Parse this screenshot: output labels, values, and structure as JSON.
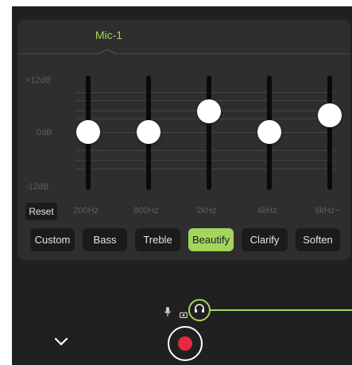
{
  "colors": {
    "accent": "#a4d65e",
    "background": "#202020",
    "panel": "#2e2e2e",
    "button": "#1b1b1b",
    "record": "#e8283f"
  },
  "eq": {
    "source_tab": "Mic-1",
    "db_labels": {
      "top": "+12dB",
      "middle": "0dB",
      "bottom": "-12dB"
    },
    "bands": [
      {
        "label": "200Hz",
        "gain_db": 0
      },
      {
        "label": "800Hz",
        "gain_db": 0
      },
      {
        "label": "2kHz",
        "gain_db": 5
      },
      {
        "label": "4kHz",
        "gain_db": 0
      },
      {
        "label": "8kHz~",
        "gain_db": 4
      }
    ],
    "reset_label": "Reset",
    "presets": [
      {
        "label": "Custom",
        "active": false
      },
      {
        "label": "Bass",
        "active": false
      },
      {
        "label": "Treble",
        "active": false
      },
      {
        "label": "Beautify",
        "active": true
      },
      {
        "label": "Clarify",
        "active": false
      },
      {
        "label": "Soften",
        "active": false
      }
    ]
  },
  "controls": {
    "icons": [
      "microphone-icon",
      "camera-icon",
      "headphone-icon",
      "chevron-down-icon",
      "record-icon"
    ]
  }
}
